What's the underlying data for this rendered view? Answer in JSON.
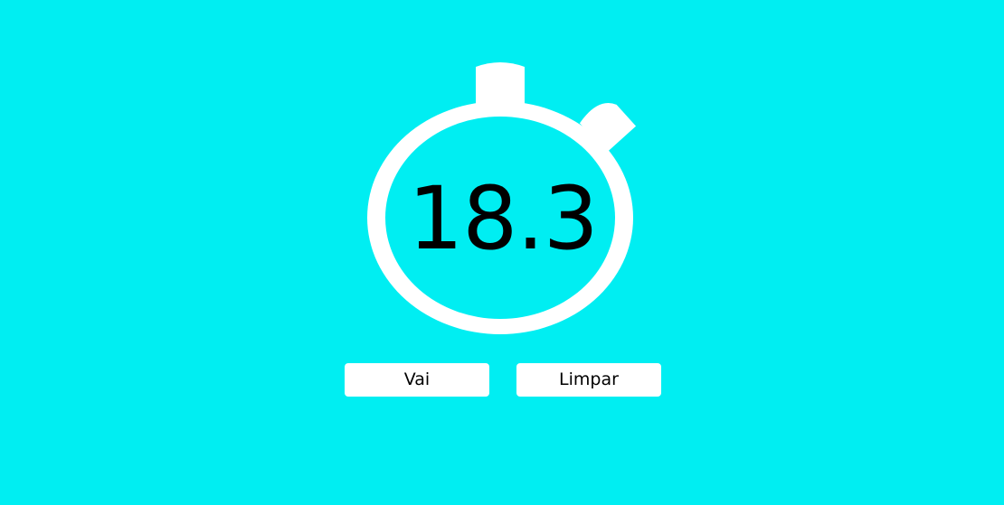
{
  "timer": {
    "value": "18.3"
  },
  "controls": {
    "start_label": "Vai",
    "clear_label": "Limpar"
  },
  "colors": {
    "background": "#00EEF2",
    "stopwatch": "#FFFFFF",
    "button_bg": "#FFFFFF",
    "text": "#000000"
  },
  "icons": {
    "stopwatch": "stopwatch-icon",
    "crown": "stopwatch-crown-icon",
    "side_button": "stopwatch-side-button-icon"
  }
}
